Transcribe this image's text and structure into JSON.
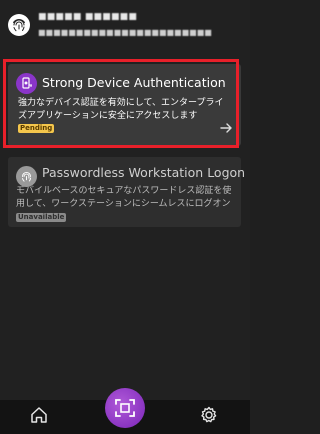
{
  "header": {
    "user_name": "■■■■■ ■■■■■■",
    "user_email": "■■■■■■■■■■■■■■■■■■■■■■■",
    "fingerprint_icon": "fingerprint-icon"
  },
  "cards": [
    {
      "title": "Strong Device Authentication",
      "description": "強力なデバイス認証を有効にして、エンタープライズアプリケーションに安全にアクセスします",
      "status": "Pending",
      "icon": "device-key-icon",
      "highlighted": true
    },
    {
      "title": "Passwordless Workstation Logon",
      "description_line1": "モバイルベースのセキュアなパスワードレス認証を使",
      "description_line2": "用して、ワークステーションにシームレスにログオン",
      "status": "Unavailable",
      "icon": "fingerprint-icon"
    }
  ],
  "colors": {
    "accent": "#8a35c9",
    "highlight": "#e8202a",
    "pending": "#f4c64c"
  },
  "bottom_nav": {
    "home_icon": "home-icon",
    "scan_icon": "scan-icon",
    "settings_icon": "gear-icon"
  }
}
